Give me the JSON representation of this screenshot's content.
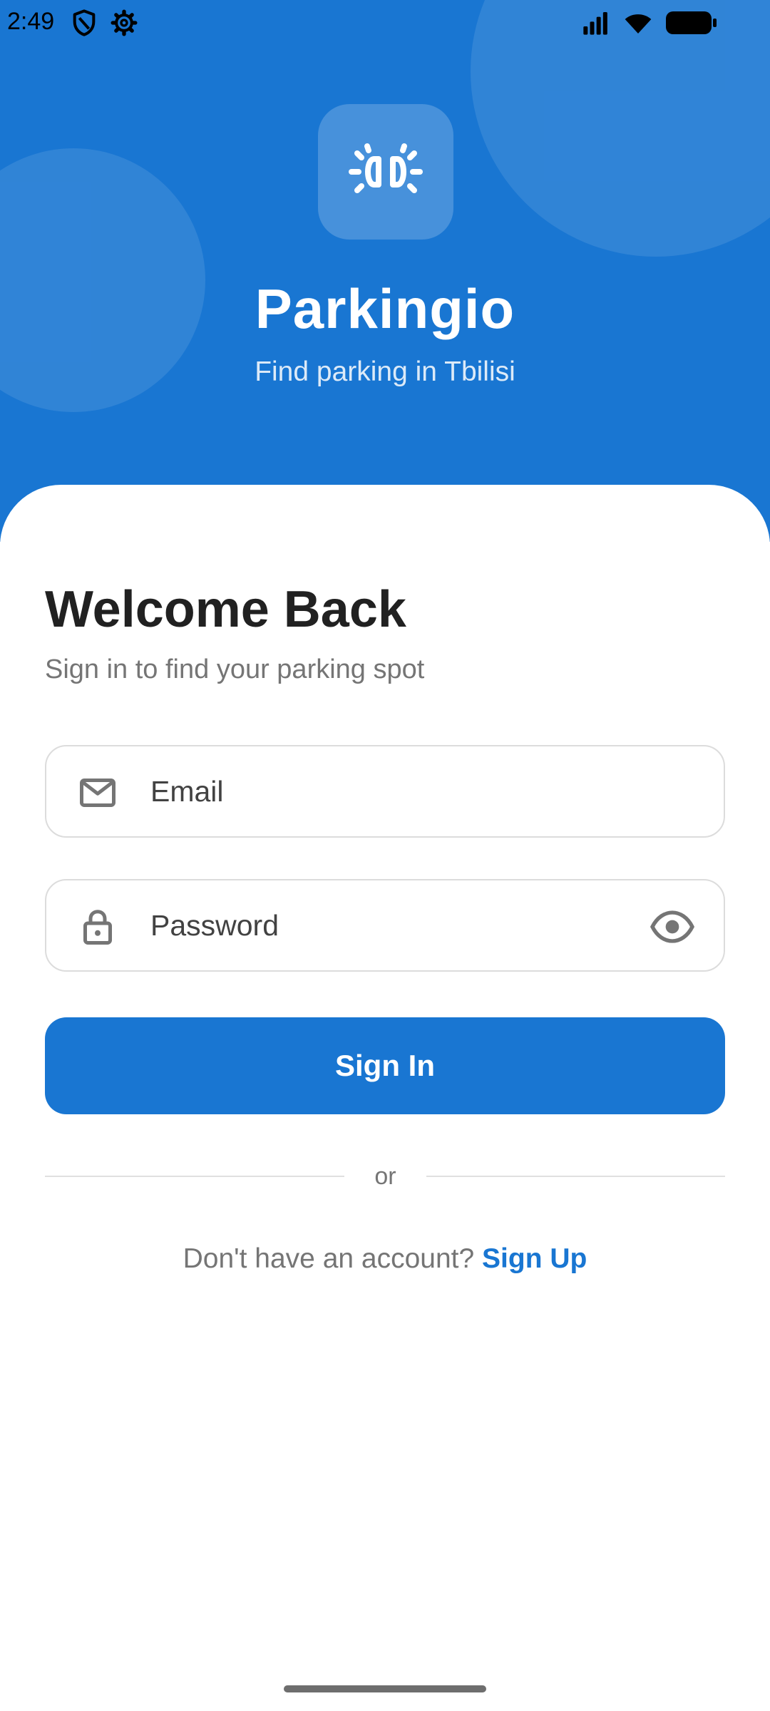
{
  "status_bar": {
    "time": "2:49",
    "icons": [
      "shield-icon",
      "gear-icon",
      "signal-icon",
      "wifi-icon",
      "battery-icon"
    ]
  },
  "header": {
    "app_name": "Parkingio",
    "tagline": "Find parking in Tbilisi",
    "logo_icon": "car-front-icon"
  },
  "login": {
    "title": "Welcome Back",
    "subtitle": "Sign in to find your parking spot",
    "email": {
      "placeholder": "Email",
      "value": "",
      "icon": "mail-icon"
    },
    "password": {
      "placeholder": "Password",
      "value": "",
      "icon": "lock-icon",
      "toggle_icon": "eye-icon"
    },
    "submit_label": "Sign In",
    "divider_label": "or",
    "signup_prompt": "Don't have an account?",
    "signup_link": "Sign Up"
  },
  "colors": {
    "primary": "#1976d2",
    "text_dark": "#212121",
    "text_muted": "#757575",
    "border": "#dcdcdc"
  }
}
